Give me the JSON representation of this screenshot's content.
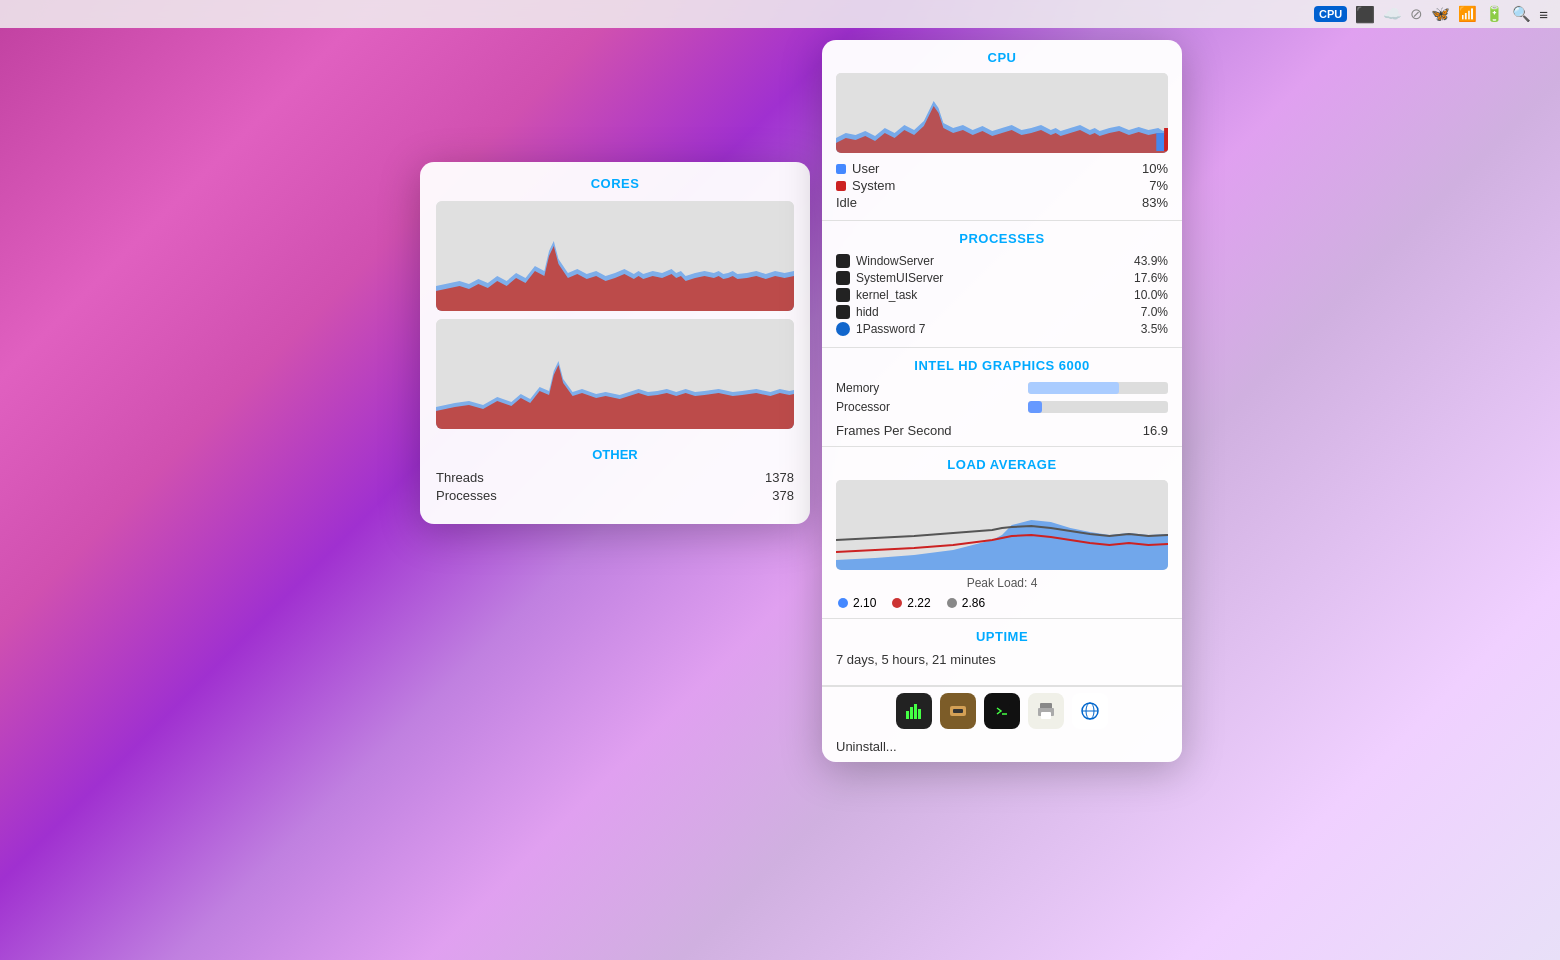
{
  "desktop": {
    "menubar": {
      "icons": [
        "cpu-indicator",
        "window-icon",
        "upload-icon",
        "block-icon",
        "butterfly-icon",
        "wifi-icon",
        "battery-icon",
        "search-icon",
        "menu-icon"
      ]
    }
  },
  "cores_panel": {
    "title": "CORES",
    "other_title": "OTHER",
    "threads_label": "Threads",
    "threads_value": "1378",
    "processes_label": "Processes",
    "processes_value": "378"
  },
  "cpu_panel": {
    "sections": {
      "cpu": {
        "title": "CPU",
        "user_label": "User",
        "user_value": "10%",
        "system_label": "System",
        "system_value": "7%",
        "idle_label": "Idle",
        "idle_value": "83%"
      },
      "processes": {
        "title": "PROCESSES",
        "items": [
          {
            "name": "WindowServer",
            "value": "43.9%"
          },
          {
            "name": "SystemUIServer",
            "value": "17.6%"
          },
          {
            "name": "kernel_task",
            "value": "10.0%"
          },
          {
            "name": "hidd",
            "value": "7.0%"
          },
          {
            "name": "1Password 7",
            "value": "3.5%"
          }
        ]
      },
      "gpu": {
        "title": "INTEL HD GRAPHICS 6000",
        "memory_label": "Memory",
        "memory_pct": 65,
        "processor_label": "Processor",
        "processor_pct": 10,
        "fps_label": "Frames Per Second",
        "fps_value": "16.9"
      },
      "load": {
        "title": "LOAD AVERAGE",
        "peak_label": "Peak Load: 4",
        "val1": "2.10",
        "val2": "2.22",
        "val3": "2.86"
      },
      "uptime": {
        "title": "UPTIME",
        "value": "7 days, 5 hours, 21 minutes"
      }
    }
  },
  "toolbar": {
    "uninstall_label": "Uninstall..."
  }
}
